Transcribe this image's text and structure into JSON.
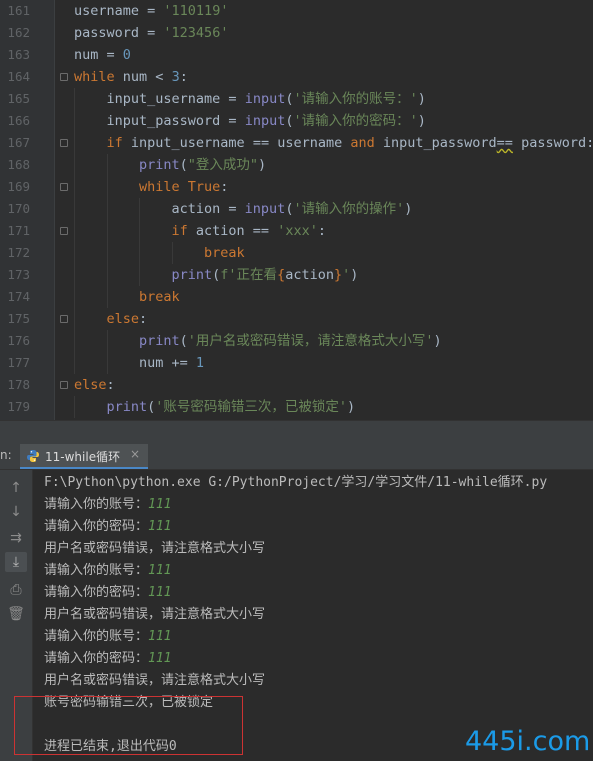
{
  "colors": {
    "editor_bg": "#2b2b2b",
    "gutter_bg": "#313335",
    "keyword": "#cc7832",
    "string": "#6a8759",
    "number": "#6897bb",
    "builtin": "#8888c6",
    "default_text": "#a9b7c6",
    "user_input": "#629755",
    "highlight_border": "#cc3333",
    "watermark": "#1b9be8",
    "tab_underline": "#4a88c7"
  },
  "editor": {
    "lines": [
      {
        "num": "161",
        "indent": 0,
        "fold": false,
        "tokens": [
          [
            "username ",
            "default"
          ],
          [
            "= ",
            "default"
          ],
          [
            "'110119'",
            "string"
          ]
        ]
      },
      {
        "num": "162",
        "indent": 0,
        "fold": false,
        "tokens": [
          [
            "password ",
            "default"
          ],
          [
            "= ",
            "default"
          ],
          [
            "'123456'",
            "string"
          ]
        ]
      },
      {
        "num": "163",
        "indent": 0,
        "fold": false,
        "tokens": [
          [
            "num ",
            "default"
          ],
          [
            "= ",
            "default"
          ],
          [
            "0",
            "number"
          ]
        ]
      },
      {
        "num": "164",
        "indent": 0,
        "fold": true,
        "tokens": [
          [
            "while ",
            "keyword"
          ],
          [
            "num ",
            "default"
          ],
          [
            "< ",
            "default"
          ],
          [
            "3",
            "number"
          ],
          [
            ":",
            "default"
          ]
        ]
      },
      {
        "num": "165",
        "indent": 1,
        "fold": false,
        "tokens": [
          [
            "input_username ",
            "default"
          ],
          [
            "= ",
            "default"
          ],
          [
            "input",
            "builtin"
          ],
          [
            "(",
            "default"
          ],
          [
            "'请输入你的账号：'",
            "string"
          ],
          [
            ")",
            "default"
          ]
        ]
      },
      {
        "num": "166",
        "indent": 1,
        "fold": false,
        "tokens": [
          [
            "input_password ",
            "default"
          ],
          [
            "= ",
            "default"
          ],
          [
            "input",
            "builtin"
          ],
          [
            "(",
            "default"
          ],
          [
            "'请输入你的密码：'",
            "string"
          ],
          [
            ")",
            "default"
          ]
        ]
      },
      {
        "num": "167",
        "indent": 1,
        "fold": true,
        "tokens": [
          [
            "if ",
            "keyword"
          ],
          [
            "input_username ",
            "default"
          ],
          [
            "== ",
            "default"
          ],
          [
            "username ",
            "default"
          ],
          [
            "and ",
            "keyword"
          ],
          [
            "input_password",
            "default"
          ],
          [
            "==",
            "warn"
          ],
          [
            " password:",
            "default"
          ]
        ]
      },
      {
        "num": "168",
        "indent": 2,
        "fold": false,
        "tokens": [
          [
            "print",
            "builtin"
          ],
          [
            "(",
            "default"
          ],
          [
            "\"登入成功\"",
            "string"
          ],
          [
            ")",
            "default"
          ]
        ]
      },
      {
        "num": "169",
        "indent": 2,
        "fold": true,
        "tokens": [
          [
            "while ",
            "keyword"
          ],
          [
            "True",
            "keyword"
          ],
          [
            ":",
            "default"
          ]
        ]
      },
      {
        "num": "170",
        "indent": 3,
        "fold": false,
        "tokens": [
          [
            "action ",
            "default"
          ],
          [
            "= ",
            "default"
          ],
          [
            "input",
            "builtin"
          ],
          [
            "(",
            "default"
          ],
          [
            "'请输入你的操作'",
            "string"
          ],
          [
            ")",
            "default"
          ]
        ]
      },
      {
        "num": "171",
        "indent": 3,
        "fold": true,
        "tokens": [
          [
            "if ",
            "keyword"
          ],
          [
            "action ",
            "default"
          ],
          [
            "== ",
            "default"
          ],
          [
            "'xxx'",
            "string"
          ],
          [
            ":",
            "default"
          ]
        ]
      },
      {
        "num": "172",
        "indent": 4,
        "fold": false,
        "tokens": [
          [
            "break",
            "keyword"
          ]
        ]
      },
      {
        "num": "173",
        "indent": 3,
        "fold": false,
        "tokens": [
          [
            "print",
            "builtin"
          ],
          [
            "(",
            "default"
          ],
          [
            "f'正在看",
            "string"
          ],
          [
            "{",
            "brace"
          ],
          [
            "action",
            "default"
          ],
          [
            "}",
            "brace"
          ],
          [
            "'",
            "string"
          ],
          [
            ")",
            "default"
          ]
        ]
      },
      {
        "num": "174",
        "indent": 2,
        "fold": false,
        "tokens": [
          [
            "break",
            "keyword"
          ]
        ]
      },
      {
        "num": "175",
        "indent": 1,
        "fold": true,
        "tokens": [
          [
            "else",
            "keyword"
          ],
          [
            ":",
            "default"
          ]
        ]
      },
      {
        "num": "176",
        "indent": 2,
        "fold": false,
        "tokens": [
          [
            "print",
            "builtin"
          ],
          [
            "(",
            "default"
          ],
          [
            "'用户名或密码错误，请注意格式大小写'",
            "string"
          ],
          [
            ")",
            "default"
          ]
        ]
      },
      {
        "num": "177",
        "indent": 2,
        "fold": false,
        "tokens": [
          [
            "num ",
            "default"
          ],
          [
            "+= ",
            "default"
          ],
          [
            "1",
            "number"
          ]
        ]
      },
      {
        "num": "178",
        "indent": 0,
        "fold": true,
        "tokens": [
          [
            "else",
            "keyword"
          ],
          [
            ":",
            "default"
          ]
        ]
      },
      {
        "num": "179",
        "indent": 1,
        "fold": false,
        "tokens": [
          [
            "print",
            "builtin"
          ],
          [
            "(",
            "default"
          ],
          [
            "'账号密码输错三次，已被锁定'",
            "string"
          ],
          [
            ")",
            "default"
          ]
        ]
      }
    ]
  },
  "run_panel": {
    "label": "n:",
    "tab": {
      "title": "11-while循环",
      "close": "×",
      "icon": "python-icon"
    },
    "toolbar": [
      {
        "name": "rerun-up-icon",
        "glyph": "↑",
        "active": false
      },
      {
        "name": "scroll-down-icon",
        "glyph": "↓",
        "active": false
      },
      {
        "name": "soft-wrap-icon",
        "glyph": "⇉",
        "active": false
      },
      {
        "name": "scroll-to-end-icon",
        "glyph": "⤓",
        "active": true
      },
      {
        "name": "print-icon",
        "glyph": "⎙",
        "active": false
      },
      {
        "name": "trash-icon",
        "glyph": "🗑",
        "active": false
      }
    ],
    "console": [
      {
        "text": "F:\\Python\\python.exe G:/PythonProject/学习/学习文件/11-while循环.py",
        "input": ""
      },
      {
        "text": "请输入你的账号：",
        "input": "111"
      },
      {
        "text": "请输入你的密码：",
        "input": "111"
      },
      {
        "text": "用户名或密码错误，请注意格式大小写",
        "input": ""
      },
      {
        "text": "请输入你的账号：",
        "input": "111"
      },
      {
        "text": "请输入你的密码：",
        "input": "111"
      },
      {
        "text": "用户名或密码错误，请注意格式大小写",
        "input": ""
      },
      {
        "text": "请输入你的账号：",
        "input": "111"
      },
      {
        "text": "请输入你的密码：",
        "input": "111"
      },
      {
        "text": "用户名或密码错误，请注意格式大小写",
        "input": ""
      },
      {
        "text": "账号密码输错三次，已被锁定",
        "input": ""
      },
      {
        "text": "",
        "input": ""
      },
      {
        "text": "进程已结束,退出代码0",
        "input": ""
      }
    ]
  },
  "watermark": "445i.com"
}
